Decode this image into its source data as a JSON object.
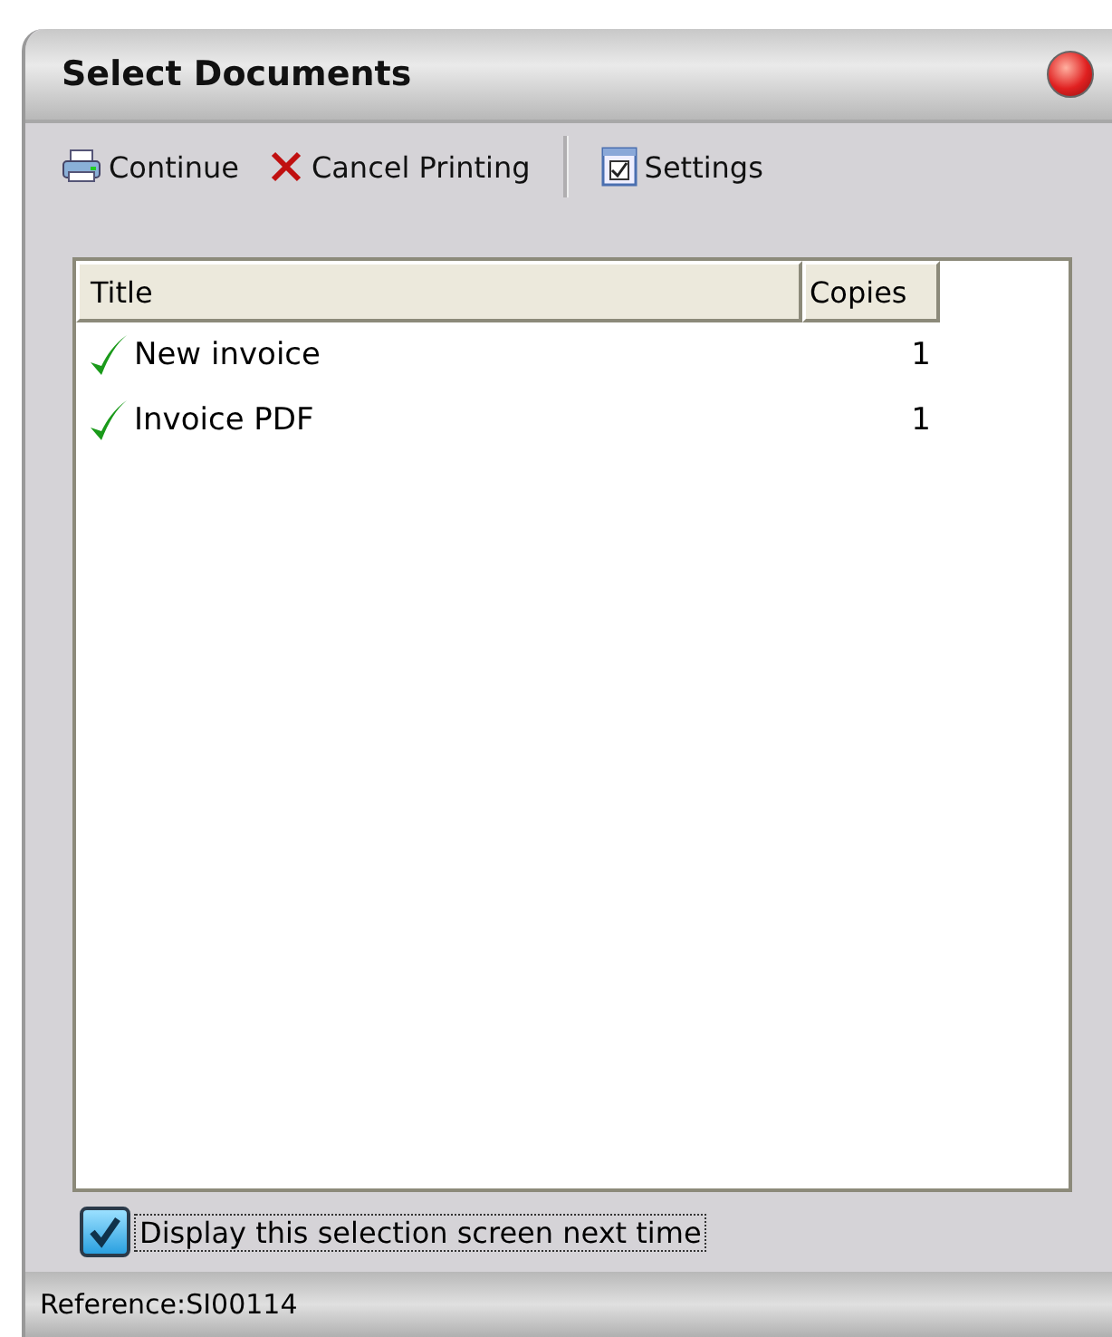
{
  "window": {
    "title": "Select Documents"
  },
  "toolbar": [
    {
      "kind": "print",
      "label": "Continue"
    },
    {
      "kind": "cancel",
      "label": "Cancel Printing"
    },
    {
      "kind": "separator"
    },
    {
      "kind": "settings",
      "label": "Settings"
    }
  ],
  "table": {
    "columns": [
      "Title",
      "Copies"
    ],
    "rows": [
      {
        "checked": true,
        "title": "New invoice",
        "copies": "1"
      },
      {
        "checked": true,
        "title": "Invoice PDF",
        "copies": "1"
      }
    ]
  },
  "option": {
    "label": "Display this selection screen next time",
    "checked": true
  },
  "status_bar": "Reference:SI00114"
}
